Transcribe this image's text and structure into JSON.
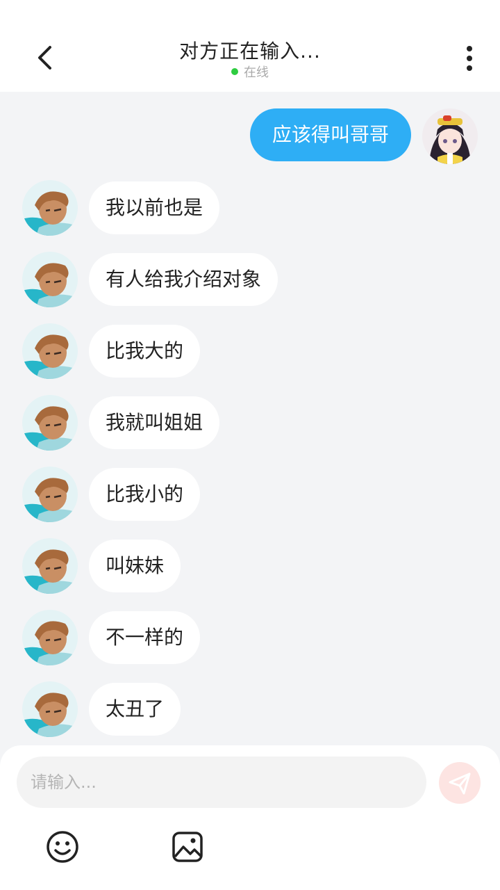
{
  "header": {
    "title": "对方正在输入...",
    "status": "在线",
    "back_icon": "chevron-left-icon",
    "more_icon": "more-vertical-icon"
  },
  "messages": [
    {
      "side": "out",
      "text": "应该得叫哥哥"
    },
    {
      "side": "in",
      "text": "我以前也是"
    },
    {
      "side": "in",
      "text": "有人给我介绍对象"
    },
    {
      "side": "in",
      "text": "比我大的"
    },
    {
      "side": "in",
      "text": "我就叫姐姐"
    },
    {
      "side": "in",
      "text": "比我小的"
    },
    {
      "side": "in",
      "text": "叫妹妹"
    },
    {
      "side": "in",
      "text": "不一样的"
    },
    {
      "side": "in",
      "text": "太丑了"
    }
  ],
  "input": {
    "placeholder": "请输入..."
  },
  "toolbar": {
    "send_icon": "send-icon",
    "emoji_icon": "smiley-icon",
    "image_icon": "image-icon"
  },
  "colors": {
    "outgoing_bubble": "#2eaef5",
    "incoming_bubble": "#ffffff",
    "online_dot": "#2ecc40",
    "send_button": "#fde4e2"
  }
}
